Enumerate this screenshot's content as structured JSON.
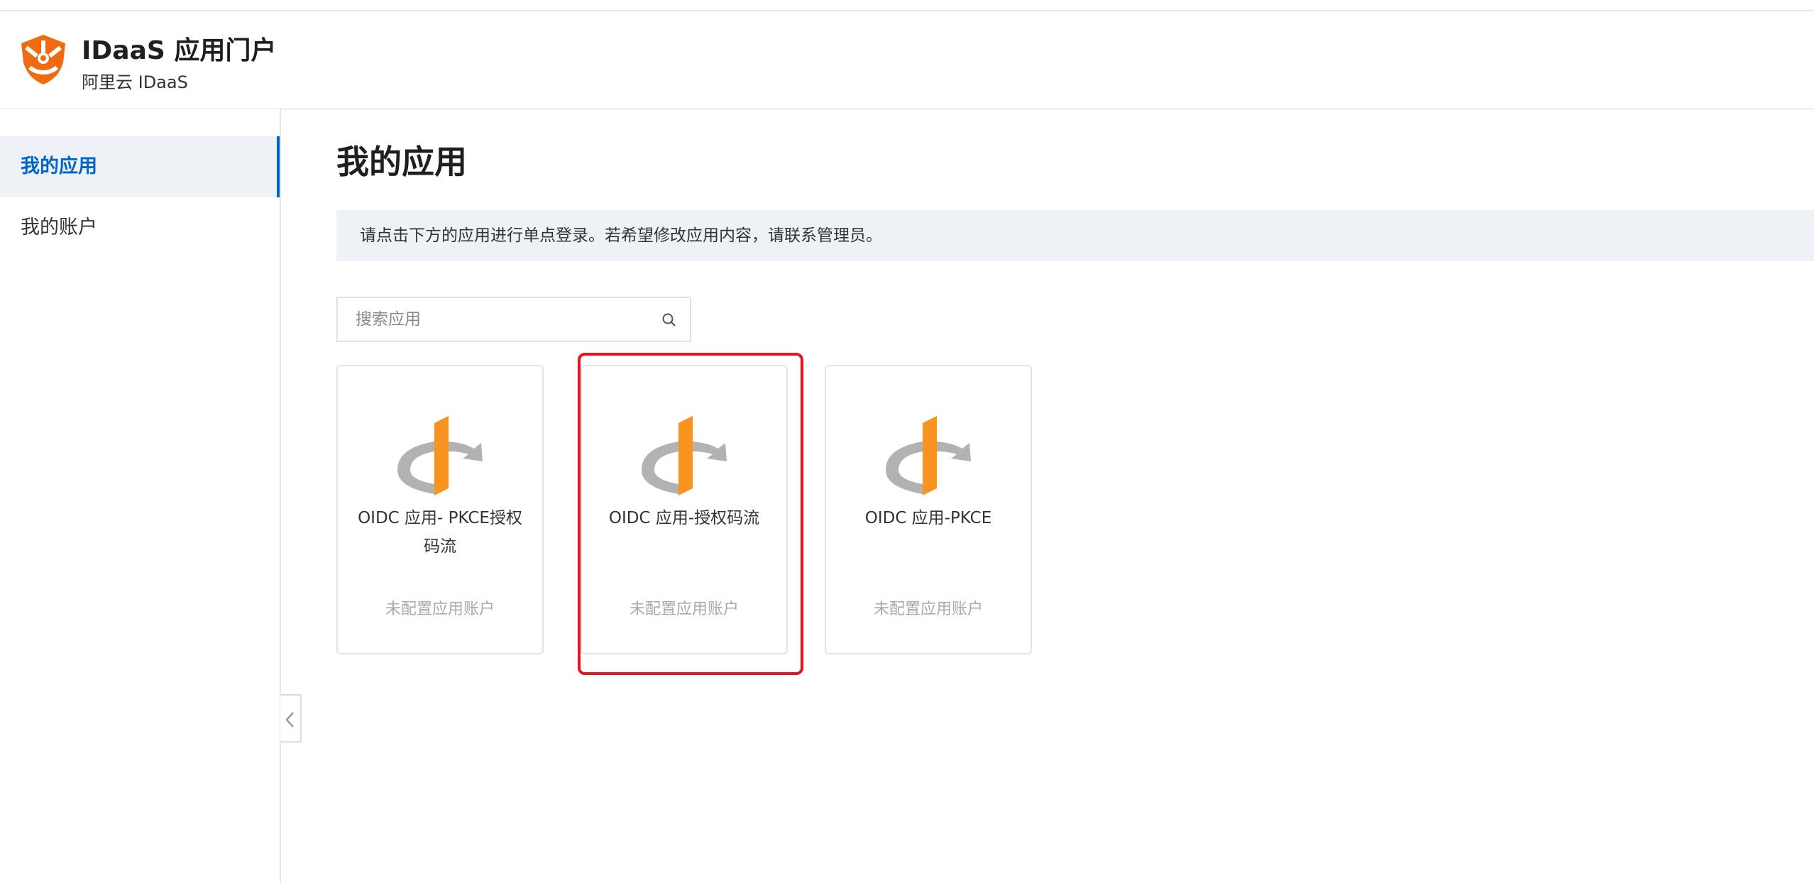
{
  "header": {
    "title": "IDaaS 应用门户",
    "subtitle": "阿里云 IDaaS",
    "logo_icon": "idaas-shield-logo",
    "brand_color": "#f06a0f"
  },
  "sidebar": {
    "items": [
      {
        "label": "我的应用",
        "active": true
      },
      {
        "label": "我的账户",
        "active": false
      }
    ],
    "collapse_icon": "chevron-left-icon",
    "active_color": "#0064c8"
  },
  "main": {
    "title": "我的应用",
    "notice": "请点击下方的应用进行单点登录。若希望修改应用内容，请联系管理员。",
    "search": {
      "placeholder": "搜索应用",
      "value": ""
    },
    "apps": [
      {
        "name": "OIDC 应用- PKCE授权码流",
        "status": "未配置应用账户",
        "icon": "openid-icon"
      },
      {
        "name": "OIDC 应用-授权码流",
        "status": "未配置应用账户",
        "icon": "openid-icon",
        "highlighted": true
      },
      {
        "name": "OIDC 应用-PKCE",
        "status": "未配置应用账户",
        "icon": "openid-icon"
      }
    ]
  },
  "colors": {
    "accent_orange": "#f7931e",
    "highlight_red": "#e8141c",
    "notice_bg": "#eef1f5"
  }
}
